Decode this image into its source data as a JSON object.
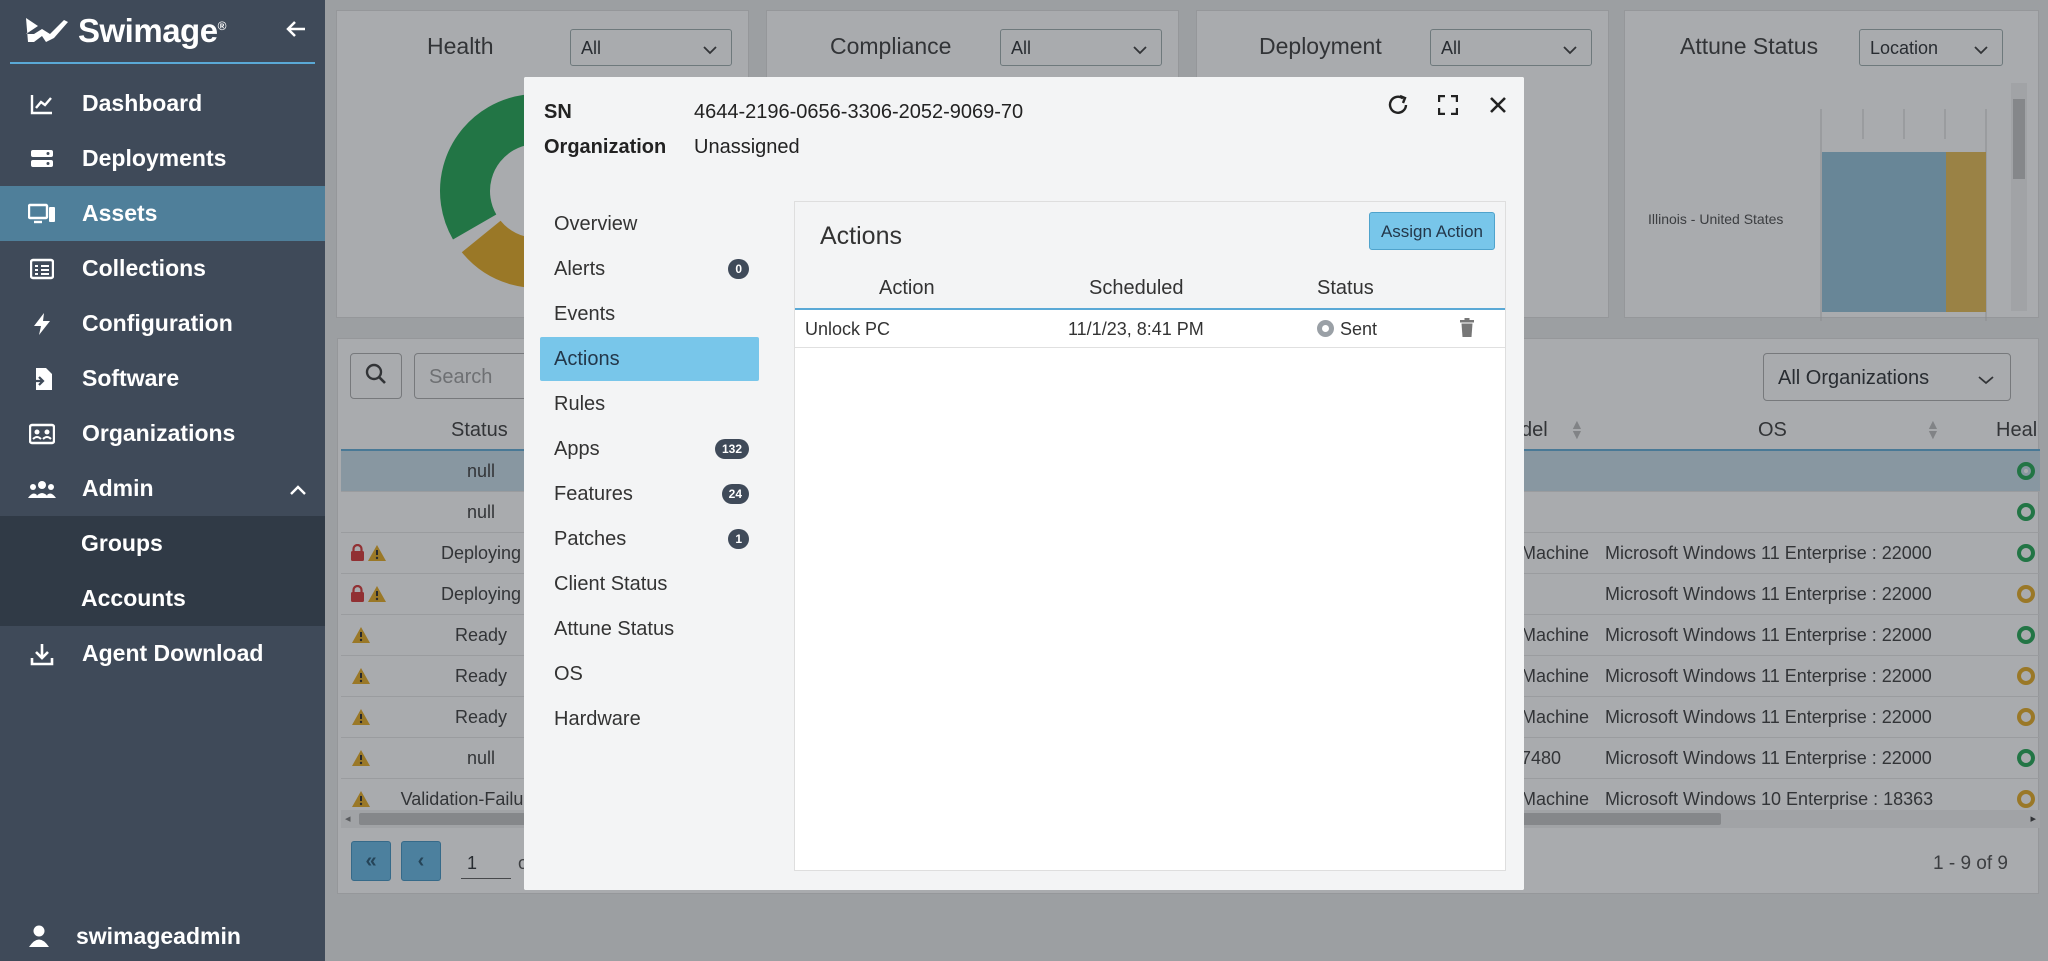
{
  "sidebar": {
    "logo_text": "Swimage",
    "logo_reg": "®",
    "collapse_icon": "arrow-left-icon",
    "items": [
      {
        "label": "Dashboard",
        "icon": "chart-line-icon"
      },
      {
        "label": "Deployments",
        "icon": "server-icon"
      },
      {
        "label": "Assets",
        "icon": "desktop-icon",
        "active": true
      },
      {
        "label": "Collections",
        "icon": "list-icon"
      },
      {
        "label": "Configuration",
        "icon": "bolt-icon"
      },
      {
        "label": "Software",
        "icon": "file-import-icon"
      },
      {
        "label": "Organizations",
        "icon": "id-card-icon"
      },
      {
        "label": "Admin",
        "icon": "users-icon",
        "expanded": true
      }
    ],
    "admin_sub": [
      {
        "label": "Groups"
      },
      {
        "label": "Accounts"
      }
    ],
    "agent_download": "Agent Download",
    "user": "swimageadmin"
  },
  "cards": [
    {
      "title": "Health",
      "filter": "All"
    },
    {
      "title": "Compliance",
      "filter": "All"
    },
    {
      "title": "Deployment",
      "filter": "All"
    },
    {
      "title": "Attune Status",
      "filter": "Location",
      "y_label": "Illinois - United States"
    }
  ],
  "health_chart": {
    "segments": [
      {
        "color": "#18a24b",
        "value": 0.55
      },
      {
        "color": "#e6a817",
        "value": 0.45
      }
    ]
  },
  "table": {
    "search_placeholder": "Search",
    "org_filter": "All Organizations",
    "headers": {
      "status": "Status",
      "model": "del",
      "os": "OS",
      "health": "Heal"
    },
    "rows": [
      {
        "status": "null",
        "model": "",
        "os": "",
        "health": "green",
        "lock": false,
        "warn": false,
        "selected": true
      },
      {
        "status": "null",
        "model": "",
        "os": "",
        "health": "green",
        "lock": false,
        "warn": false
      },
      {
        "status": "Deploying",
        "model": "Machine",
        "os": "Microsoft Windows 11 Enterprise : 22000",
        "health": "green",
        "lock": true,
        "warn": true
      },
      {
        "status": "Deploying",
        "model": "",
        "os": "Microsoft Windows 11 Enterprise : 22000",
        "health": "yellow",
        "lock": true,
        "warn": true
      },
      {
        "status": "Ready",
        "model": "Machine",
        "os": "Microsoft Windows 11 Enterprise : 22000",
        "health": "green",
        "lock": false,
        "warn": true
      },
      {
        "status": "Ready",
        "model": "Machine",
        "os": "Microsoft Windows 11 Enterprise : 22000",
        "health": "yellow",
        "lock": false,
        "warn": true
      },
      {
        "status": "Ready",
        "model": "Machine",
        "os": "Microsoft Windows 11 Enterprise : 22000",
        "health": "yellow",
        "lock": false,
        "warn": true
      },
      {
        "status": "null",
        "model": "7480",
        "os": "Microsoft Windows 11 Enterprise : 22000",
        "health": "green",
        "lock": false,
        "warn": true
      },
      {
        "status": "Validation-Failur",
        "model": "Machine",
        "os": "Microsoft Windows 10 Enterprise : 18363",
        "health": "yellow",
        "lock": false,
        "warn": true
      }
    ],
    "page": "1",
    "page_of_partial": "o",
    "paging_info": "1 - 9 of 9"
  },
  "modal": {
    "sn_label": "SN",
    "sn_value": "4644-2196-0656-3306-2052-9069-70",
    "org_label": "Organization",
    "org_value": "Unassigned",
    "nav": [
      {
        "label": "Overview"
      },
      {
        "label": "Alerts",
        "badge": "0"
      },
      {
        "label": "Events"
      },
      {
        "label": "Actions",
        "active": true
      },
      {
        "label": "Rules"
      },
      {
        "label": "Apps",
        "badge": "132"
      },
      {
        "label": "Features",
        "badge": "24"
      },
      {
        "label": "Patches",
        "badge": "1"
      },
      {
        "label": "Client Status"
      },
      {
        "label": "Attune Status"
      },
      {
        "label": "OS"
      },
      {
        "label": "Hardware"
      }
    ],
    "actions": {
      "title": "Actions",
      "assign_button": "Assign Action",
      "headers": {
        "action": "Action",
        "scheduled": "Scheduled",
        "status": "Status"
      },
      "rows": [
        {
          "action": "Unlock PC",
          "scheduled": "11/1/23, 8:41 PM",
          "status": "Sent"
        }
      ]
    }
  }
}
